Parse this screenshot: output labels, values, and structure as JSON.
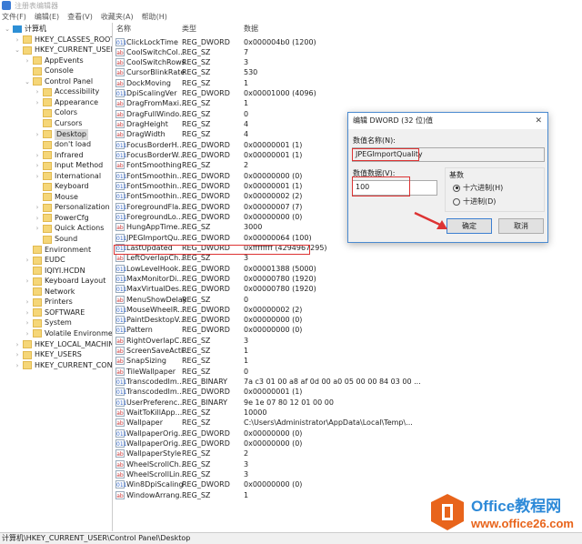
{
  "window": {
    "title": "注册表编辑器"
  },
  "menu": [
    "文件(F)",
    "编辑(E)",
    "查看(V)",
    "收藏夹(A)",
    "帮助(H)"
  ],
  "tree": [
    {
      "label": "计算机",
      "level": 0,
      "exp": "v",
      "type": "pc"
    },
    {
      "label": "HKEY_CLASSES_ROOT",
      "level": 1,
      "exp": ">"
    },
    {
      "label": "HKEY_CURRENT_USER",
      "level": 1,
      "exp": "v"
    },
    {
      "label": "AppEvents",
      "level": 2,
      "exp": ">"
    },
    {
      "label": "Console",
      "level": 2,
      "exp": ""
    },
    {
      "label": "Control Panel",
      "level": 2,
      "exp": "v"
    },
    {
      "label": "Accessibility",
      "level": 3,
      "exp": ">"
    },
    {
      "label": "Appearance",
      "level": 3,
      "exp": ">"
    },
    {
      "label": "Colors",
      "level": 3,
      "exp": ""
    },
    {
      "label": "Cursors",
      "level": 3,
      "exp": ""
    },
    {
      "label": "Desktop",
      "level": 3,
      "exp": ">",
      "selected": true
    },
    {
      "label": "don't load",
      "level": 3,
      "exp": ""
    },
    {
      "label": "Infrared",
      "level": 3,
      "exp": ">"
    },
    {
      "label": "Input Method",
      "level": 3,
      "exp": ">"
    },
    {
      "label": "International",
      "level": 3,
      "exp": ">"
    },
    {
      "label": "Keyboard",
      "level": 3,
      "exp": ""
    },
    {
      "label": "Mouse",
      "level": 3,
      "exp": ""
    },
    {
      "label": "Personalization",
      "level": 3,
      "exp": ">"
    },
    {
      "label": "PowerCfg",
      "level": 3,
      "exp": ">"
    },
    {
      "label": "Quick Actions",
      "level": 3,
      "exp": ">"
    },
    {
      "label": "Sound",
      "level": 3,
      "exp": ""
    },
    {
      "label": "Environment",
      "level": 2,
      "exp": ""
    },
    {
      "label": "EUDC",
      "level": 2,
      "exp": ">"
    },
    {
      "label": "IQIYI.HCDN",
      "level": 2,
      "exp": ""
    },
    {
      "label": "Keyboard Layout",
      "level": 2,
      "exp": ">"
    },
    {
      "label": "Network",
      "level": 2,
      "exp": ""
    },
    {
      "label": "Printers",
      "level": 2,
      "exp": ">"
    },
    {
      "label": "SOFTWARE",
      "level": 2,
      "exp": ">"
    },
    {
      "label": "System",
      "level": 2,
      "exp": ">"
    },
    {
      "label": "Volatile Environment",
      "level": 2,
      "exp": ">"
    },
    {
      "label": "HKEY_LOCAL_MACHINE",
      "level": 1,
      "exp": ">"
    },
    {
      "label": "HKEY_USERS",
      "level": 1,
      "exp": ">"
    },
    {
      "label": "HKEY_CURRENT_CONFIG",
      "level": 1,
      "exp": ">"
    }
  ],
  "columns": {
    "name": "名称",
    "type": "类型",
    "data": "数据"
  },
  "values": [
    [
      "ClickLockTime",
      "REG_DWORD",
      "0x000004b0 (1200)"
    ],
    [
      "CoolSwitchCol...",
      "REG_SZ",
      "7"
    ],
    [
      "CoolSwitchRows",
      "REG_SZ",
      "3"
    ],
    [
      "CursorBlinkRate",
      "REG_SZ",
      "530"
    ],
    [
      "DockMoving",
      "REG_SZ",
      "1"
    ],
    [
      "DpiScalingVer",
      "REG_DWORD",
      "0x00001000 (4096)"
    ],
    [
      "DragFromMaxi...",
      "REG_SZ",
      "1"
    ],
    [
      "DragFullWindo...",
      "REG_SZ",
      "0"
    ],
    [
      "DragHeight",
      "REG_SZ",
      "4"
    ],
    [
      "DragWidth",
      "REG_SZ",
      "4"
    ],
    [
      "FocusBorderH...",
      "REG_DWORD",
      "0x00000001 (1)"
    ],
    [
      "FocusBorderW...",
      "REG_DWORD",
      "0x00000001 (1)"
    ],
    [
      "FontSmoothing",
      "REG_SZ",
      "2"
    ],
    [
      "FontSmoothin...",
      "REG_DWORD",
      "0x00000000 (0)"
    ],
    [
      "FontSmoothin...",
      "REG_DWORD",
      "0x00000001 (1)"
    ],
    [
      "FontSmoothin...",
      "REG_DWORD",
      "0x00000002 (2)"
    ],
    [
      "ForegroundFla...",
      "REG_DWORD",
      "0x00000007 (7)"
    ],
    [
      "ForegroundLo...",
      "REG_DWORD",
      "0x00000000 (0)"
    ],
    [
      "HungAppTime...",
      "REG_SZ",
      "3000"
    ],
    [
      "JPEGImportQu...",
      "REG_DWORD",
      "0x00000064 (100)"
    ],
    [
      "LastUpdated",
      "REG_DWORD",
      "0xffffffff (4294967295)"
    ],
    [
      "LeftOverlapCh...",
      "REG_SZ",
      "3"
    ],
    [
      "LowLevelHook...",
      "REG_DWORD",
      "0x00001388 (5000)"
    ],
    [
      "MaxMonitorDi...",
      "REG_DWORD",
      "0x00000780 (1920)"
    ],
    [
      "MaxVirtualDes...",
      "REG_DWORD",
      "0x00000780 (1920)"
    ],
    [
      "MenuShowDelay",
      "REG_SZ",
      "0"
    ],
    [
      "MouseWheelR...",
      "REG_DWORD",
      "0x00000002 (2)"
    ],
    [
      "PaintDesktopV...",
      "REG_DWORD",
      "0x00000000 (0)"
    ],
    [
      "Pattern",
      "REG_DWORD",
      "0x00000000 (0)"
    ],
    [
      "RightOverlapC...",
      "REG_SZ",
      "3"
    ],
    [
      "ScreenSaveActi...",
      "REG_SZ",
      "1"
    ],
    [
      "SnapSizing",
      "REG_SZ",
      "1"
    ],
    [
      "TileWallpaper",
      "REG_SZ",
      "0"
    ],
    [
      "TranscodedIm...",
      "REG_BINARY",
      "7a c3 01 00 a8 af 0d 00 a0 05 00 00 84 03 00 ..."
    ],
    [
      "TranscodedIm...",
      "REG_DWORD",
      "0x00000001 (1)"
    ],
    [
      "UserPreferenc...",
      "REG_BINARY",
      "9e 1e 07 80 12 01 00 00"
    ],
    [
      "WaitToKillApp...",
      "REG_SZ",
      "10000"
    ],
    [
      "Wallpaper",
      "REG_SZ",
      "C:\\Users\\Administrator\\AppData\\Local\\Temp\\..."
    ],
    [
      "WallpaperOrig...",
      "REG_DWORD",
      "0x00000000 (0)"
    ],
    [
      "WallpaperOrig...",
      "REG_DWORD",
      "0x00000000 (0)"
    ],
    [
      "WallpaperStyle",
      "REG_SZ",
      "2"
    ],
    [
      "WheelScrollCh...",
      "REG_SZ",
      "3"
    ],
    [
      "WheelScrollLin...",
      "REG_SZ",
      "3"
    ],
    [
      "Win8DpiScaling",
      "REG_DWORD",
      "0x00000000 (0)"
    ],
    [
      "WindowArrang...",
      "REG_SZ",
      "1"
    ]
  ],
  "status": "计算机\\HKEY_CURRENT_USER\\Control Panel\\Desktop",
  "dialog": {
    "title": "编辑 DWORD (32 位)值",
    "name_label": "数值名称(N):",
    "name_value": "JPEGImportQuality",
    "data_label": "数值数据(V):",
    "data_value": "100",
    "base_label": "基数",
    "hex_label": "十六进制(H)",
    "dec_label": "十进制(D)",
    "ok": "确定",
    "cancel": "取消",
    "close": "✕"
  },
  "watermark": {
    "line1": "Office教程网",
    "line2": "www.office26.com"
  },
  "colors": {
    "highlight": "#dd3333",
    "accent": "#3c7fd1",
    "watermark": "#e8641b"
  }
}
